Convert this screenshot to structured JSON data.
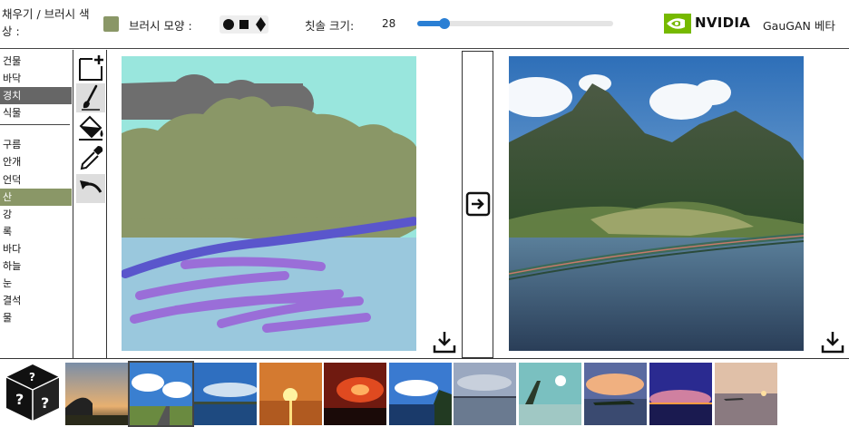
{
  "topbar": {
    "fill_label": "채우기 / 브러시 색상 :",
    "fill_color": "#8a9767",
    "brush_shape_label": "브러시 모양 :",
    "brush_shapes": [
      "circle",
      "square",
      "diamond"
    ],
    "brush_size_label": "칫솔 크기:",
    "brush_size_value": "28",
    "brush_size_fraction": 0.14,
    "brand_text": "NVIDIA",
    "brand_icon": "nvidia-eye-icon",
    "app_title": "GauGAN 베타",
    "accent_color": "#2a7fd4",
    "nvidia_green": "#76b900"
  },
  "labels": {
    "group1": [
      "건물",
      "바닥",
      "경치",
      "식물"
    ],
    "group2": [
      "구름",
      "안개",
      "언덕",
      "산",
      "강",
      "록",
      "바다",
      "하늘",
      "눈",
      "결석",
      "물"
    ],
    "selected_dark": "경치",
    "selected_olive": "산"
  },
  "tools": [
    {
      "name": "new-canvas-icon",
      "active": false
    },
    {
      "name": "brush-icon",
      "active": true
    },
    {
      "name": "paint-bucket-icon",
      "active": false
    },
    {
      "name": "eyedropper-icon",
      "active": false
    },
    {
      "name": "undo-icon",
      "active": true
    }
  ],
  "icons": {
    "download": "download-icon",
    "generate": "arrow-right-box-icon",
    "random": "random-dice-icon"
  },
  "thumbnails": {
    "count": 11,
    "selected_index": 1
  }
}
